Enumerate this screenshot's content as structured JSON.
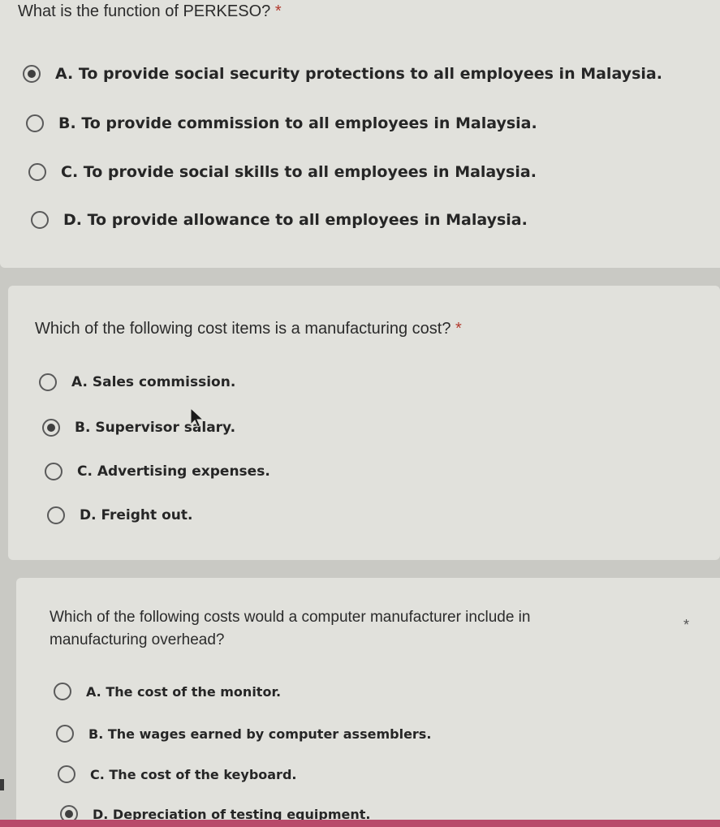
{
  "questions": [
    {
      "title": "What is the function of PERKESO?",
      "required_mark": "*",
      "options": [
        {
          "label": "A. To provide social security protections to all employees in Malaysia.",
          "selected": true
        },
        {
          "label": "B. To provide commission to all employees in Malaysia.",
          "selected": false
        },
        {
          "label": "C. To provide social skills to all employees in Malaysia.",
          "selected": false
        },
        {
          "label": "D. To provide allowance to all employees in Malaysia.",
          "selected": false
        }
      ]
    },
    {
      "title": "Which of the following cost items is a manufacturing cost?",
      "required_mark": "*",
      "options": [
        {
          "label": "A. Sales commission.",
          "selected": false
        },
        {
          "label": "B. Supervisor salary.",
          "selected": true
        },
        {
          "label": "C. Advertising expenses.",
          "selected": false
        },
        {
          "label": "D. Freight out.",
          "selected": false
        }
      ]
    },
    {
      "title_line1": "Which of the following costs would a computer manufacturer include in",
      "title_line2": "manufacturing overhead?",
      "required_mark": "*",
      "options": [
        {
          "label": "A. The cost of the monitor.",
          "selected": false
        },
        {
          "label": "B. The wages earned by computer assemblers.",
          "selected": false
        },
        {
          "label": "C. The cost of the keyboard.",
          "selected": false
        },
        {
          "label": "D. Depreciation of testing equipment.",
          "selected": true
        }
      ]
    }
  ],
  "icons": {
    "radio": "radio-button-icon",
    "cursor": "mouse-pointer-icon"
  },
  "colors": {
    "card_bg": "#e1e1dc",
    "page_bg": "#c9c9c4",
    "required": "#b23a2e",
    "text": "#262626"
  }
}
